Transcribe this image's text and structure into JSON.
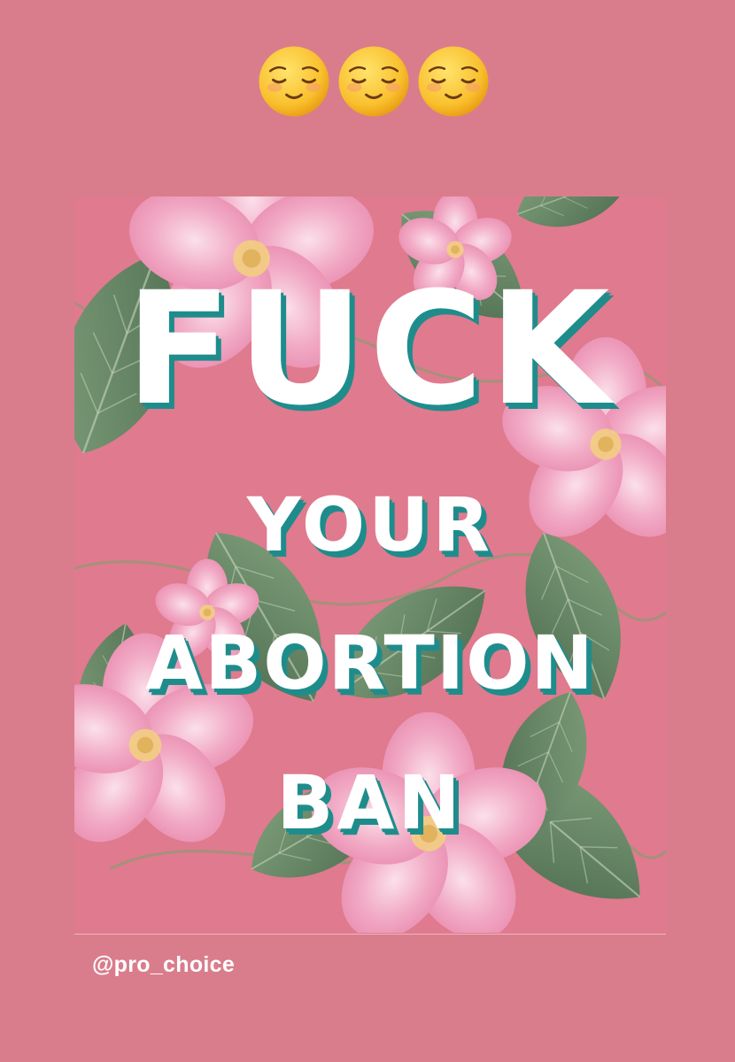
{
  "story": {
    "background_color": "#d97d8c",
    "sticker": {
      "emoji_icons": [
        "relieved-face-icon",
        "relieved-face-icon",
        "relieved-face-icon"
      ]
    },
    "shared_post": {
      "background_color": "#e07a8e",
      "text_color": "#ffffff",
      "shadow_color": "#1f8c8c",
      "slogan_lines": [
        "FUCK",
        "YOUR",
        "ABORTION",
        "BAN"
      ],
      "image": "floral-pattern-image"
    },
    "mention": "@pro_choice"
  }
}
